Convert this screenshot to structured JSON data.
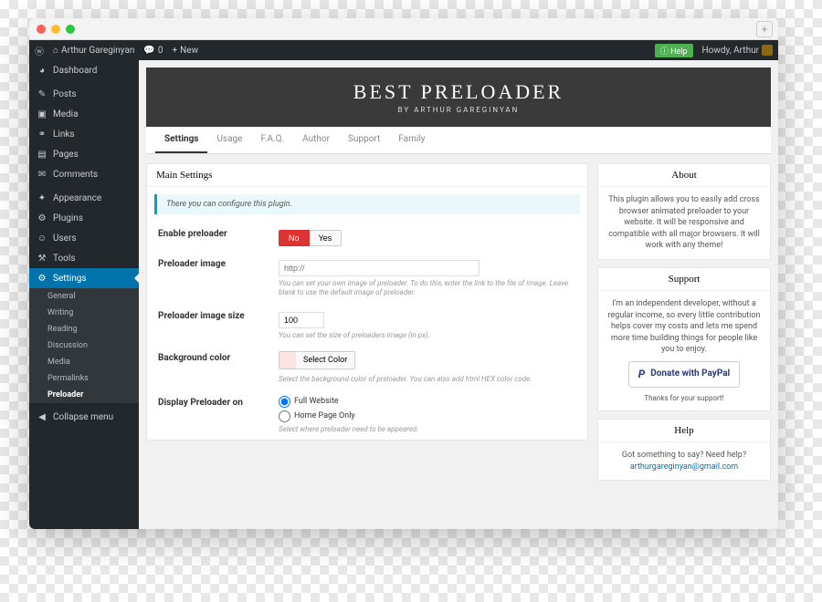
{
  "adminbar": {
    "site": "Arthur Gareginyan",
    "comments": "0",
    "new": "New",
    "help": "Help",
    "howdy": "Howdy, Arthur"
  },
  "sidebar": {
    "items": [
      {
        "label": "Dashboard",
        "icon": "◕"
      },
      {
        "label": "Posts",
        "icon": "✎"
      },
      {
        "label": "Media",
        "icon": "▣"
      },
      {
        "label": "Links",
        "icon": "⚭"
      },
      {
        "label": "Pages",
        "icon": "▤"
      },
      {
        "label": "Comments",
        "icon": "✉"
      },
      {
        "label": "Appearance",
        "icon": "✦"
      },
      {
        "label": "Plugins",
        "icon": "⚙"
      },
      {
        "label": "Users",
        "icon": "☺"
      },
      {
        "label": "Tools",
        "icon": "⚒"
      },
      {
        "label": "Settings",
        "icon": "⚙"
      }
    ],
    "subs": [
      "General",
      "Writing",
      "Reading",
      "Discussion",
      "Media",
      "Permalinks",
      "Preloader"
    ],
    "collapse": "Collapse menu"
  },
  "hero": {
    "title": "BEST PRELOADER",
    "subtitle": "BY ARTHUR GAREGINYAN"
  },
  "tabs": [
    "Settings",
    "Usage",
    "F.A.Q.",
    "Author",
    "Support",
    "Family"
  ],
  "main": {
    "title": "Main Settings",
    "notice": "There you can configure this plugin.",
    "enable": {
      "label": "Enable preloader",
      "no": "No",
      "yes": "Yes"
    },
    "image": {
      "label": "Preloader image",
      "placeholder": "http://",
      "desc": "You can set your own image of preloader. To do this, enter the link to the file of image. Leave blank to use the default image of preloader."
    },
    "size": {
      "label": "Preloader image size",
      "value": "100",
      "desc": "You can set the size of preloaders image (in px)."
    },
    "bg": {
      "label": "Background color",
      "btn": "Select Color",
      "desc": "Select the background color of preloader. You can also add html HEX color code."
    },
    "display": {
      "label": "Display Preloader on",
      "opt1": "Full Website",
      "opt2": "Home Page Only",
      "desc": "Select where preloader need to be appeared."
    }
  },
  "about": {
    "title": "About",
    "body": "This plugin allows you to easily add cross browser animated preloader to your website. It will be responsive and compatible with all major browsers. It will work with any theme!"
  },
  "support": {
    "title": "Support",
    "body": "I'm an independent developer, without a regular income, so every little contribution helps cover my costs and lets me spend more time building things for people like you to enjoy.",
    "donate": "Donate with PayPal",
    "thanks": "Thanks for your support!"
  },
  "helpbox": {
    "title": "Help",
    "body": "Got something to say? Need help?",
    "email": "arthurgareginyan@gmail.com"
  }
}
